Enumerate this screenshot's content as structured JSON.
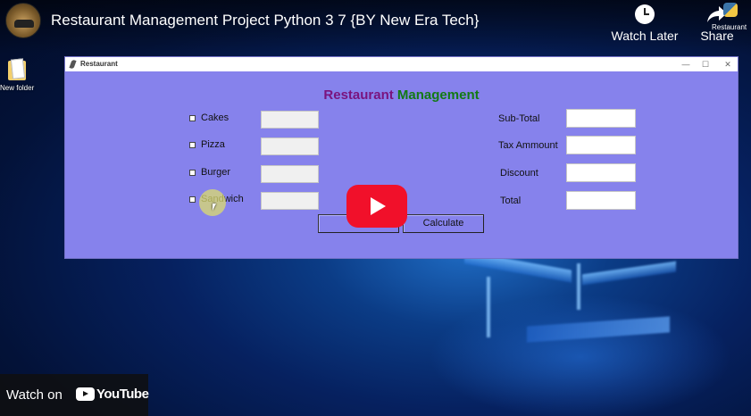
{
  "video": {
    "title": "Restaurant Management Project Python 3 7 {BY New Era Tech}",
    "watch_later_label": "Watch Later",
    "share_label": "Share",
    "share_thumb_label": "Restaurant",
    "watch_on_label": "Watch on",
    "brand_label": "YouTube"
  },
  "desktop": {
    "folder_label": "New folder"
  },
  "window": {
    "title": "Restaurant",
    "minimize_glyph": "—",
    "maximize_glyph": "☐",
    "close_glyph": "✕"
  },
  "app": {
    "heading_part1": "Restaurant",
    "heading_part2": "Management",
    "heading_color1": "#7a137e",
    "heading_color2": "#127a13",
    "background": "#8682ec",
    "items": [
      {
        "label": "Cakes",
        "quantity": ""
      },
      {
        "label": "Pizza",
        "quantity": ""
      },
      {
        "label": "Burger",
        "quantity": ""
      },
      {
        "label": "Sandwich",
        "quantity": ""
      }
    ],
    "summary": [
      {
        "label": "Sub-Total",
        "value": ""
      },
      {
        "label": "Tax Ammount",
        "value": ""
      },
      {
        "label": "Discount",
        "value": ""
      },
      {
        "label": "Total",
        "value": ""
      }
    ],
    "reset_label": "",
    "calculate_label": "Calculate"
  },
  "icons": [
    "clock-icon",
    "share-icon",
    "folder-icon",
    "feather-icon",
    "play-icon",
    "youtube-logo-icon",
    "cursor-icon"
  ]
}
